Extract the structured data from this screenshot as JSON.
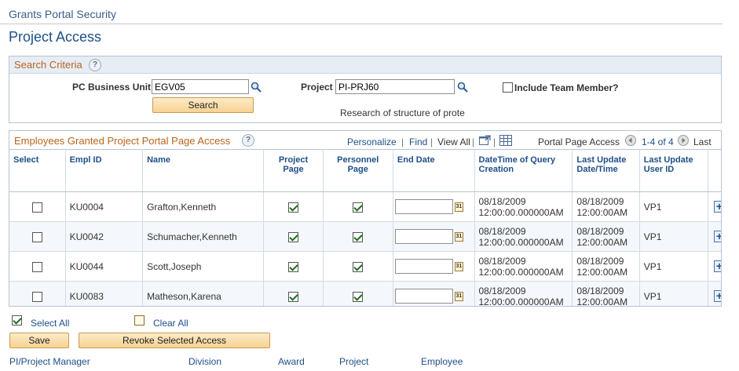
{
  "header": {
    "portal_title": "Grants Portal Security",
    "page_title": "Project Access"
  },
  "search": {
    "title": "Search Criteria",
    "help": "?",
    "business_unit_label": "PC Business Unit",
    "business_unit_value": "EGV05",
    "project_label": "Project",
    "project_value": "PI-PRJ60",
    "include_team_label": "Include Team Member?",
    "search_button": "Search",
    "project_description": "Research of structure of prote"
  },
  "grid": {
    "title": "Employees Granted Project Portal Page Access",
    "help": "?",
    "nav": {
      "personalize": "Personalize",
      "find": "Find",
      "view_all": "View All",
      "portal_page_access": "Portal Page Access",
      "range": "1-4 of 4",
      "last": "Last",
      "sep": "|"
    },
    "columns": {
      "select": "Select",
      "empl_id": "Empl ID",
      "name": "Name",
      "project_page": "Project Page",
      "personnel_page": "Personnel Page",
      "end_date": "End Date",
      "datetime_query": "DateTime of Query Creation",
      "last_update_dt": "Last Update Date/Time",
      "last_update_user": "Last Update User ID"
    },
    "rows": [
      {
        "empl_id": "KU0004",
        "name": "Grafton,Kenneth",
        "created_date": "08/18/2009",
        "created_time": "12:00:00.000000AM",
        "upd_date": "08/18/2009",
        "upd_time": "12:00:00AM",
        "user": "VP1"
      },
      {
        "empl_id": "KU0042",
        "name": "Schumacher,Kenneth",
        "created_date": "08/18/2009",
        "created_time": "12:00:00.000000AM",
        "upd_date": "08/18/2009",
        "upd_time": "12:00:00AM",
        "user": "VP1"
      },
      {
        "empl_id": "KU0044",
        "name": "Scott,Joseph",
        "created_date": "08/18/2009",
        "created_time": "12:00:00.000000AM",
        "upd_date": "08/18/2009",
        "upd_time": "12:00:00AM",
        "user": "VP1"
      },
      {
        "empl_id": "KU0083",
        "name": "Matheson,Karena",
        "created_date": "08/18/2009",
        "created_time": "12:00:00.000000AM",
        "upd_date": "08/18/2009",
        "upd_time": "12:00:00AM",
        "user": "VP1"
      }
    ],
    "calendar_glyph": "31",
    "add_glyph": "+"
  },
  "actions": {
    "select_all": "Select All",
    "clear_all": "Clear All",
    "save": "Save",
    "revoke": "Revoke Selected Access"
  },
  "footer_links": [
    "PI/Project Manager",
    "Division",
    "Award",
    "Project",
    "Employee"
  ],
  "colors": {
    "link": "#1e4f8a",
    "section_title": "#b8651b",
    "button": "#f7d292"
  }
}
